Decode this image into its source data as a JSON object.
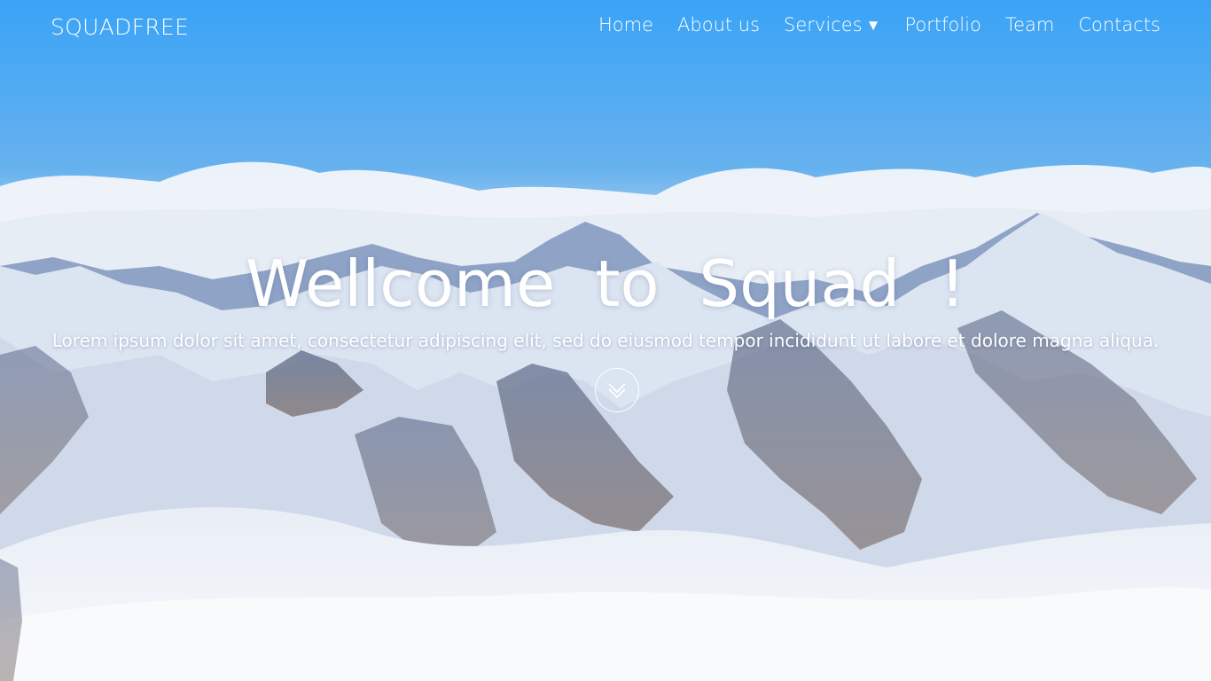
{
  "brand": "SQUADFREE",
  "nav": {
    "items": [
      {
        "label": "Home"
      },
      {
        "label": "About us"
      },
      {
        "label": "Services",
        "caret": "▼"
      },
      {
        "label": "Portfolio"
      },
      {
        "label": "Team"
      },
      {
        "label": "Contacts"
      }
    ]
  },
  "hero": {
    "headline": "Wellcome to Squad !",
    "subtext": "Lorem ipsum dolor sit amet, consectetur adipiscing elit, sed do eiusmod tempor incididunt ut labore et dolore magna aliqua.",
    "scroll_icon": "double-chevron-down-icon"
  },
  "colors": {
    "sky_top": "#3aa2f5",
    "text": "#ffffff"
  }
}
